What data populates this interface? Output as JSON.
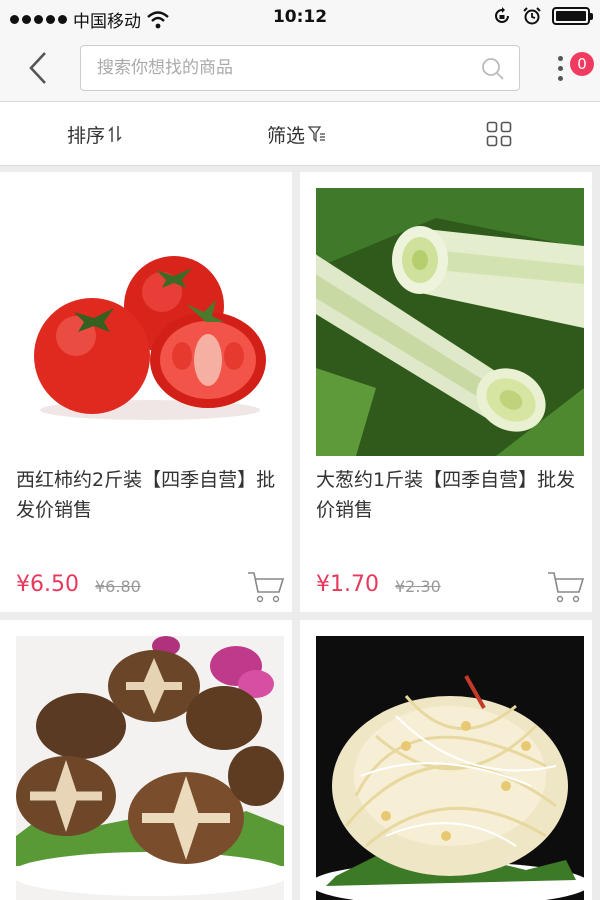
{
  "status_bar": {
    "carrier": "中国移动",
    "time": "10:12"
  },
  "search": {
    "placeholder": "搜索你想找的商品"
  },
  "cart_badge": "0",
  "filters": {
    "sort_label": "排序",
    "filter_label": "筛选"
  },
  "products": [
    {
      "title": "西红柿约2斤装【四季自营】批发价销售",
      "price": "¥6.50",
      "original_price": "¥6.80",
      "image": "tomato"
    },
    {
      "title": "大葱约1斤装【四季自营】批发价销售",
      "price": "¥1.70",
      "original_price": "¥2.30",
      "image": "scallion"
    },
    {
      "title": "",
      "price": "",
      "original_price": "",
      "image": "shiitake-mushroom"
    },
    {
      "title": "",
      "price": "",
      "original_price": "",
      "image": "bean-sprouts"
    }
  ],
  "colors": {
    "accent": "#e8395c",
    "badge": "#f03a5f",
    "background": "#ececec"
  }
}
